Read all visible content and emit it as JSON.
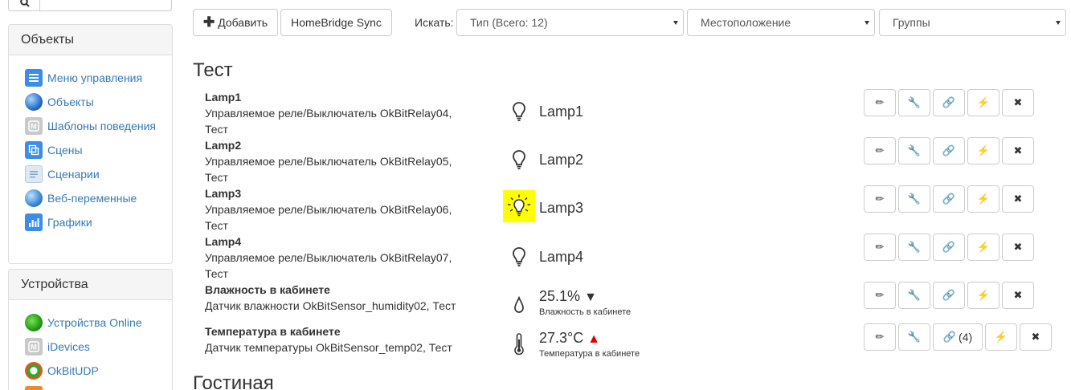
{
  "sidebar": {
    "search": {
      "value": "",
      "placeholder": ""
    },
    "objects_panel": {
      "title": "Объекты",
      "items": [
        {
          "label": "Меню управления",
          "icon": "menu-icon"
        },
        {
          "label": "Объекты",
          "icon": "globe-icon"
        },
        {
          "label": "Шаблоны поведения",
          "icon": "template-icon"
        },
        {
          "label": "Сцены",
          "icon": "scenes-icon"
        },
        {
          "label": "Сценарии",
          "icon": "scripts-icon"
        },
        {
          "label": "Веб-переменные",
          "icon": "web-globe-icon"
        },
        {
          "label": "Графики",
          "icon": "chart-icon"
        }
      ]
    },
    "devices_panel": {
      "title": "Устройства",
      "items": [
        {
          "label": "Устройства Online",
          "icon": "online-icon"
        },
        {
          "label": "iDevices",
          "icon": "idevices-icon"
        },
        {
          "label": "OkBitUDP",
          "icon": "okbit-icon"
        }
      ]
    }
  },
  "toolbar": {
    "add_label": "Добавить",
    "homebridge_label": "HomeBridge Sync",
    "search_label": "Искать:",
    "type_select": "Тип (Всего: 12)",
    "location_select": "Местоположение",
    "groups_select": "Группы"
  },
  "sections": [
    {
      "title": "Тест",
      "devices": [
        {
          "name": "Lamp1",
          "desc": "Управляемое реле/Выключатель OkBitRelay04, Тест",
          "value": "Lamp1",
          "icon": "bulb-off-icon",
          "state": "off"
        },
        {
          "name": "Lamp2",
          "desc": "Управляемое реле/Выключатель OkBitRelay05, Тест",
          "value": "Lamp2",
          "icon": "bulb-off-icon",
          "state": "off"
        },
        {
          "name": "Lamp3",
          "desc": "Управляемое реле/Выключатель OkBitRelay06, Тест",
          "value": "Lamp3",
          "icon": "bulb-on-icon",
          "state": "on"
        },
        {
          "name": "Lamp4",
          "desc": "Управляемое реле/Выключатель OkBitRelay07, Тест",
          "value": "Lamp4",
          "icon": "bulb-off-icon",
          "state": "off"
        },
        {
          "name": "Влажность в кабинете",
          "desc": "Датчик влажности OkBitSensor_humidity02, Тест",
          "value": "25.1%",
          "trend": "▼",
          "sub": "Влажность в кабинете",
          "icon": "droplet-icon"
        },
        {
          "name": "Температура в кабинете",
          "desc": "Датчик температуры OkBitSensor_temp02, Тест",
          "value": "27.3°C",
          "trend": "▲",
          "sub": "Температура в кабинете",
          "icon": "thermometer-icon",
          "links_count": "(4)"
        }
      ]
    },
    {
      "title": "Гостиная"
    }
  ],
  "colors": {
    "link": "#337ab7",
    "lamp_on_bg": "#ffff00",
    "trend_up": "#e00000"
  }
}
